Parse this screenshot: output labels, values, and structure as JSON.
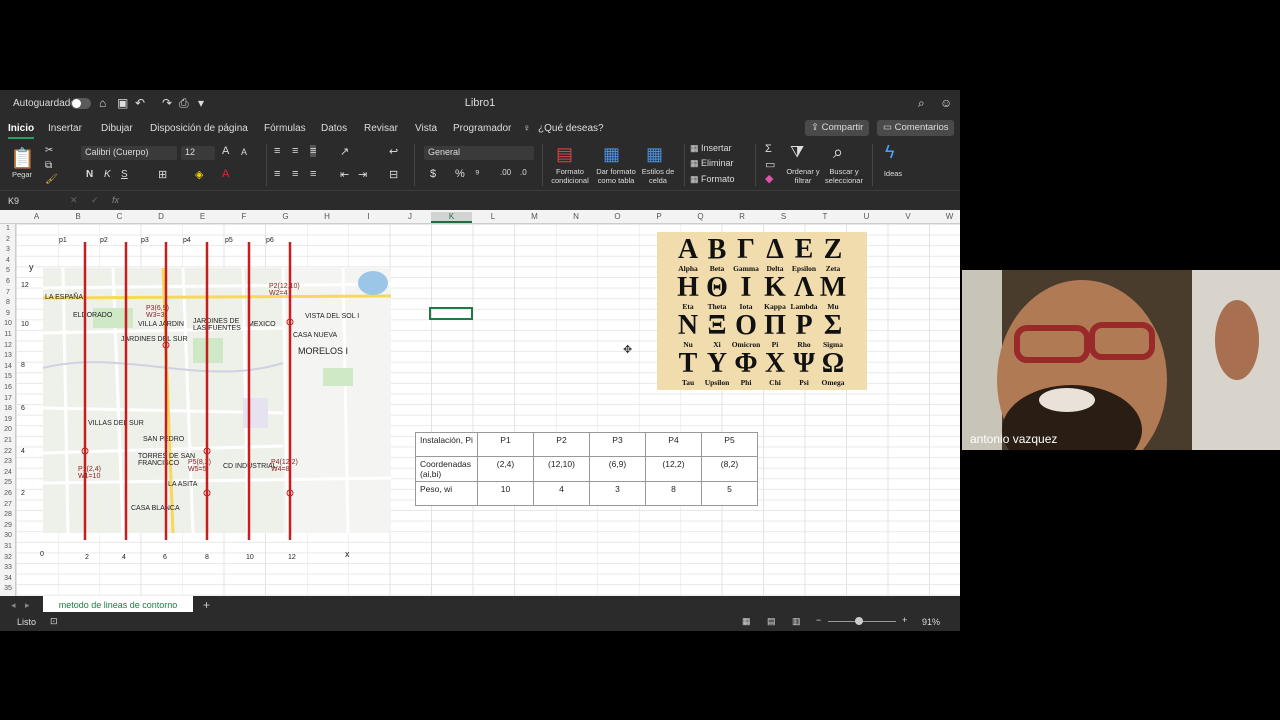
{
  "app": {
    "autosave_label": "Autoguardado",
    "doc_title": "Libro1"
  },
  "tabs": [
    "Inicio",
    "Insertar",
    "Dibujar",
    "Disposición de página",
    "Fórmulas",
    "Datos",
    "Revisar",
    "Vista",
    "Programador"
  ],
  "tell_me": "¿Qué deseas?",
  "share_label": "Compartir",
  "comments_label": "Comentarios",
  "ribbon": {
    "paste": "Pegar",
    "font_name": "Calibri (Cuerpo)",
    "font_size": "12",
    "bold": "N",
    "italic": "K",
    "underline": "S",
    "number_format": "General",
    "cond_format": "Formato condicional",
    "format_table": "Dar formato como tabla",
    "cell_styles": "Estilos de celda",
    "insert": "Insertar",
    "delete": "Eliminar",
    "format": "Formato",
    "sort_filter": "Ordenar y filtrar",
    "find_select": "Buscar y seleccionar",
    "ideas": "Ideas"
  },
  "formula_bar": {
    "name_box": "K9",
    "fx": "fx"
  },
  "columns": [
    "A",
    "B",
    "C",
    "D",
    "E",
    "F",
    "G",
    "H",
    "I",
    "J",
    "K",
    "L",
    "M",
    "N",
    "O",
    "P",
    "Q",
    "R",
    "S",
    "T",
    "U",
    "V",
    "W"
  ],
  "rows": [
    "1",
    "2",
    "3",
    "4",
    "5",
    "6",
    "7",
    "8",
    "9",
    "10",
    "11",
    "12",
    "13",
    "14",
    "15",
    "16",
    "17",
    "18",
    "19",
    "20",
    "21",
    "22",
    "23",
    "24",
    "25",
    "26",
    "27",
    "28",
    "29",
    "30",
    "31",
    "32",
    "33",
    "34",
    "35"
  ],
  "sheet_tab": "metodo de lineas de contorno",
  "status": {
    "ready": "Listo",
    "zoom": "91%"
  },
  "plot": {
    "p_labels": [
      "p1",
      "p2",
      "p3",
      "p4",
      "p5",
      "p6"
    ],
    "y_label": "y",
    "x_label": "x",
    "y_ticks": [
      "12",
      "10",
      "8",
      "6",
      "4",
      "2"
    ],
    "x_ticks": [
      "0",
      "2",
      "4",
      "6",
      "8",
      "10",
      "12"
    ]
  },
  "map_labels": [
    "LA ESPAÑA",
    "ELDORADO",
    "VILLA JARDIN",
    "JARDINES DEL SUR",
    "JARDINES DE LAS FUENTES",
    "MEXICO",
    "CASA NUEVA",
    "MORELOS I",
    "VILLAS DEL SUR",
    "SAN PEDRO",
    "TORRES DE SAN FRANCISCO",
    "CASA BLANCA",
    "LA ASITA",
    "VISTA DEL SOL I",
    "CD INDUSTRIAL",
    "P1(2,4) W1=10",
    "P2(12,10) W2=4",
    "P3(6,9) W3=3",
    "P4(12,2) W4=8",
    "P5(8,2) W5=5"
  ],
  "greek": [
    [
      [
        "Α",
        "Alpha"
      ],
      [
        "Β",
        "Beta"
      ],
      [
        "Γ",
        "Gamma"
      ],
      [
        "Δ",
        "Delta"
      ],
      [
        "Ε",
        "Epsilon"
      ],
      [
        "Ζ",
        "Zeta"
      ]
    ],
    [
      [
        "Η",
        "Eta"
      ],
      [
        "Θ",
        "Theta"
      ],
      [
        "Ι",
        "Iota"
      ],
      [
        "Κ",
        "Kappa"
      ],
      [
        "Λ",
        "Lambda"
      ],
      [
        "Μ",
        "Mu"
      ]
    ],
    [
      [
        "Ν",
        "Nu"
      ],
      [
        "Ξ",
        "Xi"
      ],
      [
        "Ο",
        "Omicron"
      ],
      [
        "Π",
        "Pi"
      ],
      [
        "Ρ",
        "Rho"
      ],
      [
        "Σ",
        "Sigma"
      ]
    ],
    [
      [
        "Τ",
        "Tau"
      ],
      [
        "Υ",
        "Upsilon"
      ],
      [
        "Φ",
        "Phi"
      ],
      [
        "Χ",
        "Chi"
      ],
      [
        "Ψ",
        "Psi"
      ],
      [
        "Ω",
        "Omega"
      ]
    ]
  ],
  "table": {
    "row_labels": [
      "Instalación, Pi",
      "Coordenadas (ai,bi)",
      "Peso, wi"
    ],
    "headers": [
      "P1",
      "P2",
      "P3",
      "P4",
      "P5"
    ],
    "coords": [
      "(2,4)",
      "(12,10)",
      "(6,9)",
      "(12,2)",
      "(8,2)"
    ],
    "weights": [
      "10",
      "4",
      "3",
      "8",
      "5"
    ]
  },
  "webcam": {
    "name": "antonio vazquez"
  }
}
